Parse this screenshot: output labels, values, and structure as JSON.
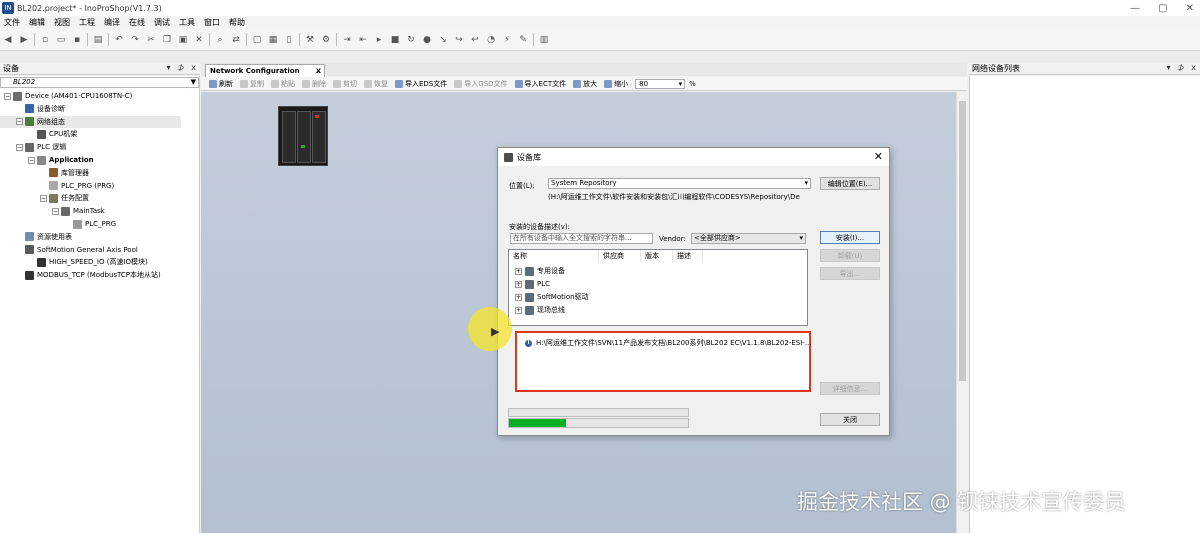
{
  "window": {
    "title": "BL202.project* - InoProShop(V1.7.3)",
    "logo": "IN",
    "minimize": "—",
    "maximize": "▢",
    "close": "✕"
  },
  "menu": [
    "文件",
    "编辑",
    "视图",
    "工程",
    "编译",
    "在线",
    "调试",
    "工具",
    "窗口",
    "帮助"
  ],
  "left_panel": {
    "title": "设备",
    "ctrl_pin": "▾",
    "ctrl_float": "⊅",
    "ctrl_close": "x",
    "device_selector": "BL202",
    "tree": [
      {
        "label": "Device (AM401-CPU1608TN-C)",
        "indent": 1,
        "exp": "⊟",
        "icon_color": "#6d6d6d"
      },
      {
        "label": "设备诊断",
        "indent": 2,
        "exp": "",
        "icon_color": "#3465a4"
      },
      {
        "label": "网络组态",
        "indent": 2,
        "exp": "⊟",
        "icon_color": "#4e7a3a",
        "selected": true
      },
      {
        "label": "CPU机架",
        "indent": 3,
        "exp": "",
        "icon_color": "#555555"
      },
      {
        "label": "PLC 逻辑",
        "indent": 2,
        "exp": "⊟",
        "icon_color": "#666666"
      },
      {
        "label": "Application",
        "indent": 3,
        "exp": "⊟",
        "icon_color": "#888888",
        "bold": true
      },
      {
        "label": "库管理器",
        "indent": 4,
        "exp": "",
        "icon_color": "#8a5a2b"
      },
      {
        "label": "PLC_PRG (PRG)",
        "indent": 4,
        "exp": "",
        "icon_color": "#aaaaaa"
      },
      {
        "label": "任务配置",
        "indent": 4,
        "exp": "⊟",
        "icon_color": "#7a7a5a"
      },
      {
        "label": "MainTask",
        "indent": 5,
        "exp": "⊟",
        "icon_color": "#6a6a6a"
      },
      {
        "label": "PLC_PRG",
        "indent": 6,
        "exp": "",
        "icon_color": "#999999"
      },
      {
        "label": "资源使用表",
        "indent": 2,
        "exp": "",
        "icon_color": "#6f8fb0"
      },
      {
        "label": "SoftMotion General Axis Pool",
        "indent": 2,
        "exp": "",
        "icon_color": "#5a5a5a"
      },
      {
        "label": "HIGH_SPEED_IO (高速IO模块)",
        "indent": 3,
        "exp": "",
        "icon_color": "#333333"
      },
      {
        "label": "MODBUS_TCP (ModbusTCP本地从站)",
        "indent": 2,
        "exp": "",
        "icon_color": "#333333"
      }
    ]
  },
  "doc_tab": {
    "label": "Network Configuration",
    "close": "x"
  },
  "net_toolbar": {
    "refresh": "刷新",
    "copy": "复制",
    "paste": "粘贴",
    "delete": "删除",
    "cut": "剪切",
    "restore": "恢复",
    "import_eds": "导入EDS文件",
    "import_gsd": "导入GSD文件",
    "import_ect": "导入ECT文件",
    "zoom_in": "放大",
    "zoom_out": "缩小",
    "zoom_value": "80",
    "zoom_unit": "%"
  },
  "right_panel": {
    "title": "网络设备列表",
    "ctrl_pin": "▾",
    "ctrl_float": "⊅",
    "ctrl_close": "x"
  },
  "dialog": {
    "title": "设备库",
    "close": "✕",
    "location_label": "位置(L):",
    "location_value": "System Repository",
    "location_path": "(H:\\阿运维工作文件\\软件安装和安装包\\汇川编程软件\\CODESYS\\Repository\\De",
    "edit_location": "编辑位置(E)...",
    "installed_label": "安装的设备描述(v):",
    "search_placeholder": "在所有设备中输入全文搜索的字符串...",
    "vendor_label": "Vendor:",
    "vendor_value": "<全部供应商>",
    "install_btn": "安装(I)...",
    "uninstall_btn": "卸载(U)",
    "export_btn": "导出...",
    "columns": [
      "名称",
      "供应商",
      "版本",
      "描述"
    ],
    "list_items": [
      "专用设备",
      "PLC",
      "SoftMotion驱动",
      "现场总线"
    ],
    "message": "H:\\阿运维工作文件\\SVN\\11产品发布文档\\BL200系列\\BL202 EC\\V1.1.8\\BL202-ESI-...",
    "info_icon": "i",
    "details_btn": "详细信息...",
    "close_btn": "关闭",
    "progress": 0.32
  },
  "watermark": "掘金技术社区 @ 钡铼技术宣传委员",
  "cursor": "▶"
}
